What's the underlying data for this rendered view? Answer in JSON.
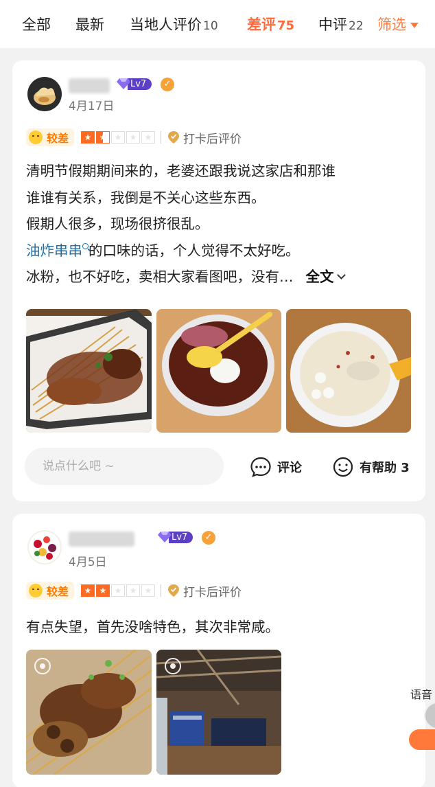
{
  "tabs": [
    {
      "label": "全部",
      "count": ""
    },
    {
      "label": "最新",
      "count": ""
    },
    {
      "label": "当地人评价",
      "count": "10"
    },
    {
      "label": "差评",
      "count": "75"
    },
    {
      "label": "中评",
      "count": "22"
    }
  ],
  "filter_label": "筛选",
  "accent_color": "#ff6a3a",
  "reviews": [
    {
      "level": "Lv7",
      "date": "4月17日",
      "mood": "较差",
      "stars": 1.5,
      "checkin": "打卡后评价",
      "lines": [
        "清明节假期期间来的，老婆还跟我说这家店和那谁",
        "谁谁有关系，我倒是不关心这些东西。",
        "假期人很多，现场很挤很乱。"
      ],
      "dish": "油炸串串",
      "dish_line_rest": "的口味的话，个人觉得不太好吃。",
      "last_line": "冰粉，也不好吃，卖相大家看图吧，没有…",
      "full_text": "全文",
      "comment_placeholder": "说点什么吧 ~",
      "comment_label": "评论",
      "helpful_label": "有帮助 3"
    },
    {
      "level": "Lv7",
      "date": "4月5日",
      "mood": "较差",
      "stars": 2,
      "checkin": "打卡后评价",
      "text": "有点失望，首先没啥特色，其次非常咸。"
    }
  ],
  "floating": {
    "voice_label": "语音"
  }
}
